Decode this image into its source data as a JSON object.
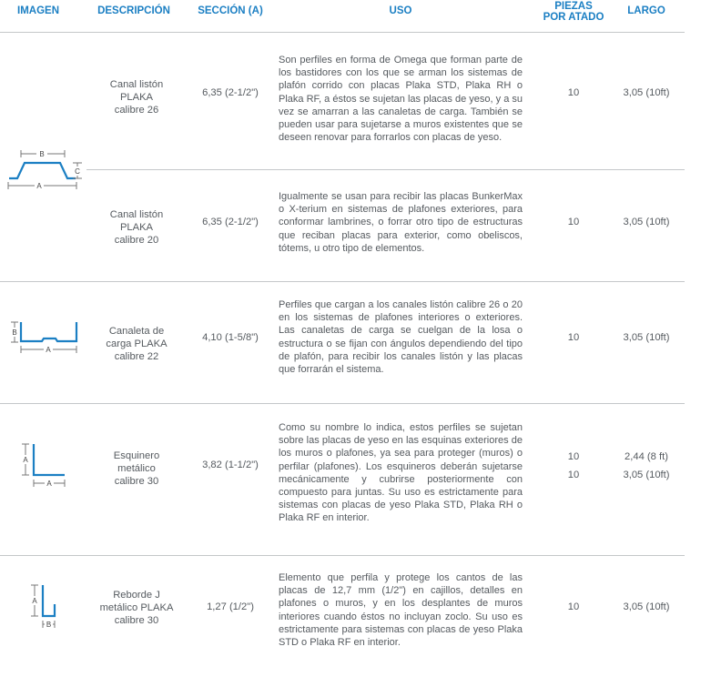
{
  "headers": {
    "imagen": "IMAGEN",
    "descripcion": "DESCRIPCIÓN",
    "seccion": "SECCIÓN (A)",
    "uso": "USO",
    "piezas_line1": "PIEZAS",
    "piezas_line2": "POR ATADO",
    "largo": "LARGO"
  },
  "rows": [
    {
      "desc": [
        "Canal listón",
        "PLAKA",
        "calibre 26"
      ],
      "seccion": "6,35 (2-1/2\")",
      "uso": "Son perfiles en forma de Omega que forman parte de los bastidores con los que se arman los sistemas de plafón corrido con placas Plaka STD, Plaka RH o Plaka RF, a éstos se sujetan las placas de yeso, y a su vez se amarran a las canaletas de carga. También se pueden usar para sujetarse a muros existentes que se deseen renovar para forrarlos con placas de yeso.",
      "piezas": [
        "10"
      ],
      "largo": [
        "3,05 (10ft)"
      ]
    },
    {
      "desc": [
        "Canal listón",
        "PLAKA",
        "calibre 20"
      ],
      "seccion": "6,35 (2-1/2\")",
      "uso": "Igualmente se usan para recibir las placas BunkerMax o X-terium en sistemas de plafones exteriores, para conformar lambrines, o forrar otro tipo de estructuras que reciban placas para exterior, como obeliscos, tótems, u otro tipo de elementos.",
      "piezas": [
        "10"
      ],
      "largo": [
        "3,05 (10ft)"
      ]
    },
    {
      "desc": [
        "Canaleta de",
        "carga PLAKA",
        "calibre 22"
      ],
      "seccion": "4,10 (1-5/8\")",
      "uso": "Perfiles que cargan a los canales listón calibre 26 o 20 en los sistemas de plafones interiores o exteriores. Las canaletas de carga se cuelgan de la losa o estructura o se fijan con ángulos dependiendo del tipo de plafón, para recibir los canales listón y las placas que forrarán el sistema.",
      "piezas": [
        "10"
      ],
      "largo": [
        "3,05 (10ft)"
      ]
    },
    {
      "desc": [
        "Esquinero",
        "metálico",
        "calibre 30"
      ],
      "seccion": "3,82 (1-1/2\")",
      "uso": "Como su nombre lo indica, estos perfiles se sujetan sobre las placas de yeso en las esquinas exteriores de los muros o plafones, ya sea para proteger (muros) o perfilar (plafones). Los esquineros deberán sujetarse mecánicamente y cubrirse posteriormente con compuesto para juntas. Su uso es estrictamente para sistemas con placas de yeso Plaka STD, Plaka RH o Plaka RF en interior.",
      "piezas": [
        "10",
        "10"
      ],
      "largo": [
        "2,44 (8 ft)",
        "3,05 (10ft)"
      ]
    },
    {
      "desc": [
        "Reborde J",
        "metálico PLAKA",
        "calibre 30"
      ],
      "seccion": "1,27 (1/2\")",
      "uso": "Elemento que perfila y protege los cantos de las placas de 12,7 mm (1/2\") en cajillos, detalles en plafones o muros, y en los desplantes de muros interiores cuando éstos no incluyan zoclo. Su uso es estrictamente para sistemas con placas de yeso Plaka STD o Plaka RF en interior.",
      "piezas": [
        "10"
      ],
      "largo": [
        "3,05 (10ft)"
      ]
    }
  ],
  "icon_labels": {
    "omega": {
      "a": "A",
      "b": "B",
      "c": "C"
    },
    "canaleta": {
      "a": "A",
      "b": "B"
    },
    "esquinero": {
      "a": "A"
    },
    "reborde": {
      "a": "A",
      "b": "B"
    }
  },
  "colors": {
    "accent": "#1b7fc3",
    "text": "#555a5f",
    "rule": "#c4c7c9"
  }
}
